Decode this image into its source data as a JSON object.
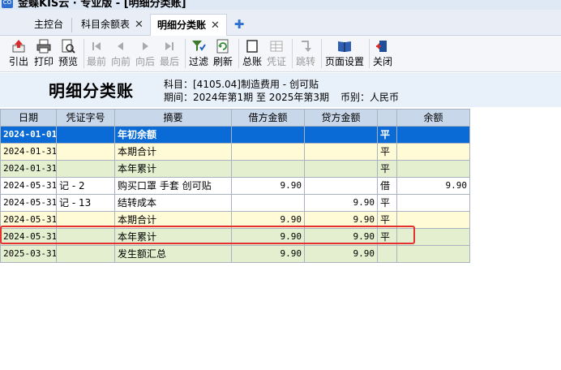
{
  "window": {
    "title": "金蝶KIS云 · 专业版 - [明细分类账]",
    "logo": "CO"
  },
  "tabs": [
    {
      "label": "主控台",
      "closable": false,
      "active": false
    },
    {
      "label": "科目余额表",
      "closable": true,
      "active": false
    },
    {
      "label": "明细分类账",
      "closable": true,
      "active": true
    }
  ],
  "tab_close_glyph": "✕",
  "tab_add_glyph": "✚",
  "toolbar": {
    "preview_label": "引出",
    "print_label": "打印",
    "preview2_label": "预览",
    "first_label": "最前",
    "prev_label": "向前",
    "next_label": "向后",
    "last_label": "最后",
    "filter_label": "过滤",
    "refresh_label": "刷新",
    "general_ledger_label": "总账",
    "voucher_label": "凭证",
    "jump_label": "跳转",
    "page_setup_label": "页面设置",
    "close_label": "关闭"
  },
  "report": {
    "title": "明细分类账",
    "account": "科目：[4105.04]制造费用 - 创可贴",
    "period": "期间：2024年第1期 至 2025年第3期",
    "currency": "币别：人民币"
  },
  "table": {
    "headers": [
      "日期",
      "凭证字号",
      "摘要",
      "借方金额",
      "贷方金额",
      "",
      "余额"
    ],
    "rows": [
      {
        "date": "2024-01-01",
        "voucher": "",
        "summary": "年初余额",
        "debit": "",
        "credit": "",
        "dir": "平",
        "balance": "",
        "style": "sel"
      },
      {
        "date": "2024-01-31",
        "voucher": "",
        "summary": "本期合计",
        "debit": "",
        "credit": "",
        "dir": "平",
        "balance": "",
        "style": "yellow"
      },
      {
        "date": "2024-01-31",
        "voucher": "",
        "summary": "本年累计",
        "debit": "",
        "credit": "",
        "dir": "平",
        "balance": "",
        "style": "green"
      },
      {
        "date": "2024-05-31",
        "voucher": "记 - 2",
        "summary": "购买口罩 手套  创可贴",
        "debit": "9.90",
        "credit": "",
        "dir": "借",
        "balance": "9.90",
        "style": "white"
      },
      {
        "date": "2024-05-31",
        "voucher": "记 - 13",
        "summary": "结转成本",
        "debit": "",
        "credit": "9.90",
        "dir": "平",
        "balance": "",
        "style": "white"
      },
      {
        "date": "2024-05-31",
        "voucher": "",
        "summary": "本期合计",
        "debit": "9.90",
        "credit": "9.90",
        "dir": "平",
        "balance": "",
        "style": "yellow"
      },
      {
        "date": "2024-05-31",
        "voucher": "",
        "summary": "本年累计",
        "debit": "9.90",
        "credit": "9.90",
        "dir": "平",
        "balance": "",
        "style": "green"
      },
      {
        "date": "2025-03-31",
        "voucher": "",
        "summary": "发生额汇总",
        "debit": "9.90",
        "credit": "9.90",
        "dir": "",
        "balance": "",
        "style": "green"
      }
    ]
  },
  "colors": {
    "selected_row": "#0a6bd6",
    "highlight_box": "#e53030",
    "header_bg": "#c9d7ea"
  }
}
